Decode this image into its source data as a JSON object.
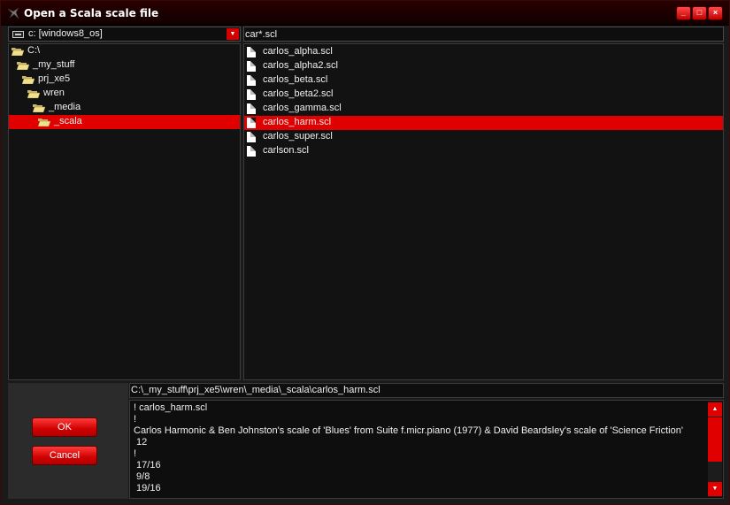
{
  "window": {
    "title": "Open a Scala scale file"
  },
  "drive": {
    "value": "c: [windows8_os]"
  },
  "filter": {
    "value": "car*.scl"
  },
  "tree": {
    "items": [
      {
        "label": "C:\\",
        "depth": 0,
        "open": true,
        "selected": false
      },
      {
        "label": "_my_stuff",
        "depth": 1,
        "open": true,
        "selected": false
      },
      {
        "label": "prj_xe5",
        "depth": 2,
        "open": true,
        "selected": false
      },
      {
        "label": "wren",
        "depth": 3,
        "open": true,
        "selected": false
      },
      {
        "label": "_media",
        "depth": 4,
        "open": true,
        "selected": false
      },
      {
        "label": "_scala",
        "depth": 5,
        "open": true,
        "selected": true
      }
    ]
  },
  "files": {
    "items": [
      {
        "label": "carlos_alpha.scl",
        "selected": false
      },
      {
        "label": "carlos_alpha2.scl",
        "selected": false
      },
      {
        "label": "carlos_beta.scl",
        "selected": false
      },
      {
        "label": "carlos_beta2.scl",
        "selected": false
      },
      {
        "label": "carlos_gamma.scl",
        "selected": false
      },
      {
        "label": "carlos_harm.scl",
        "selected": true
      },
      {
        "label": "carlos_super.scl",
        "selected": false
      },
      {
        "label": "carlson.scl",
        "selected": false
      }
    ]
  },
  "buttons": {
    "ok": "OK",
    "cancel": "Cancel"
  },
  "path": {
    "value": "C:\\_my_stuff\\prj_xe5\\wren\\_media\\_scala\\carlos_harm.scl"
  },
  "preview": {
    "lines": [
      "! carlos_harm.scl",
      "!",
      "Carlos Harmonic & Ben Johnston's scale of 'Blues' from Suite f.micr.piano (1977) & David Beardsley's scale of 'Science Friction'",
      " 12",
      "!",
      " 17/16",
      " 9/8",
      " 19/16"
    ]
  },
  "colors": {
    "accent": "#e00000",
    "background": "#1a1a1a",
    "panel": "#121212"
  }
}
